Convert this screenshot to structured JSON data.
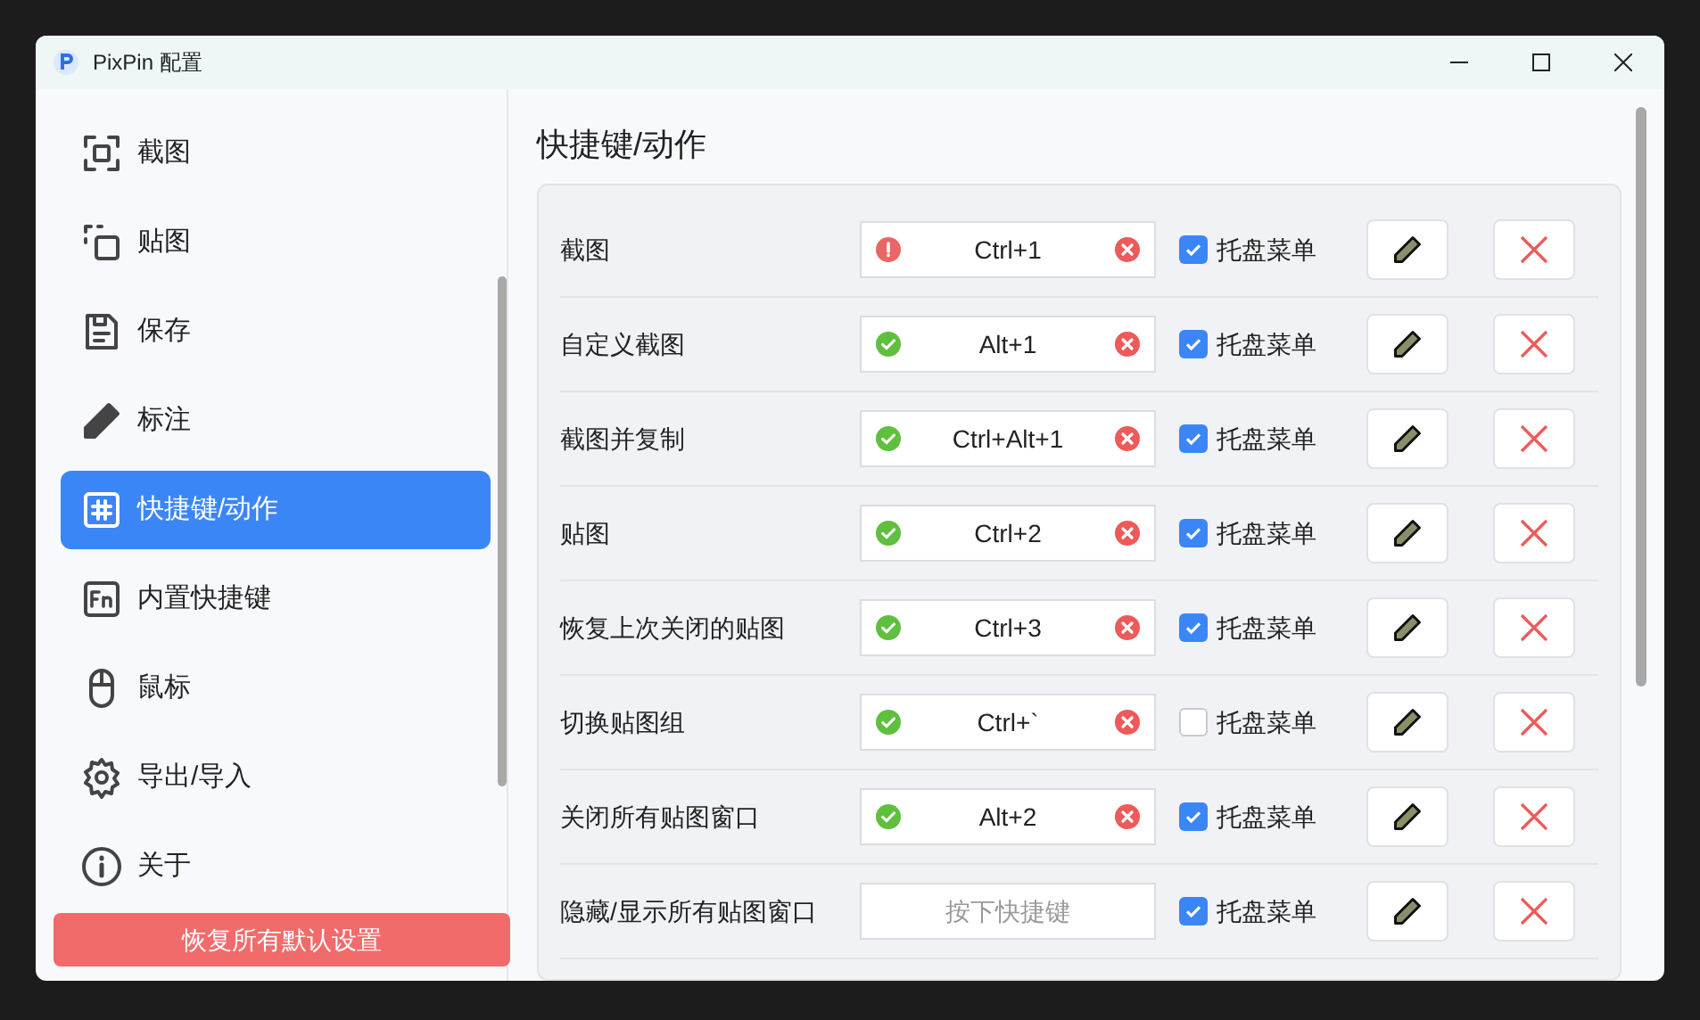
{
  "window": {
    "title": "PixPin 配置"
  },
  "sidebar": {
    "items": [
      {
        "label": "截图",
        "selected": false
      },
      {
        "label": "贴图",
        "selected": false
      },
      {
        "label": "保存",
        "selected": false
      },
      {
        "label": "标注",
        "selected": false
      },
      {
        "label": "快捷键/动作",
        "selected": true
      },
      {
        "label": "内置快捷键",
        "selected": false
      },
      {
        "label": "鼠标",
        "selected": false
      },
      {
        "label": "导出/导入",
        "selected": false
      },
      {
        "label": "关于",
        "selected": false
      }
    ],
    "reset_button": "恢复所有默认设置"
  },
  "page": {
    "title": "快捷键/动作",
    "rows": [
      {
        "label": "截图",
        "kind": "error",
        "value": "Ctrl+1",
        "tray_checked": true,
        "tray_label": "托盘菜单"
      },
      {
        "label": "自定义截图",
        "kind": "ok",
        "value": "Alt+1",
        "tray_checked": true,
        "tray_label": "托盘菜单"
      },
      {
        "label": "截图并复制",
        "kind": "ok",
        "value": "Ctrl+Alt+1",
        "tray_checked": true,
        "tray_label": "托盘菜单"
      },
      {
        "label": "贴图",
        "kind": "ok",
        "value": "Ctrl+2",
        "tray_checked": true,
        "tray_label": "托盘菜单"
      },
      {
        "label": "恢复上次关闭的贴图",
        "kind": "ok",
        "value": "Ctrl+3",
        "tray_checked": true,
        "tray_label": "托盘菜单"
      },
      {
        "label": "切换贴图组",
        "kind": "ok",
        "value": "Ctrl+`",
        "tray_checked": false,
        "tray_label": "托盘菜单"
      },
      {
        "label": "关闭所有贴图窗口",
        "kind": "ok",
        "value": "Alt+2",
        "tray_checked": true,
        "tray_label": "托盘菜单"
      },
      {
        "label": "隐藏/显示所有贴图窗口",
        "kind": "empty",
        "placeholder": "按下快捷键",
        "tray_checked": true,
        "tray_label": "托盘菜单"
      }
    ]
  }
}
